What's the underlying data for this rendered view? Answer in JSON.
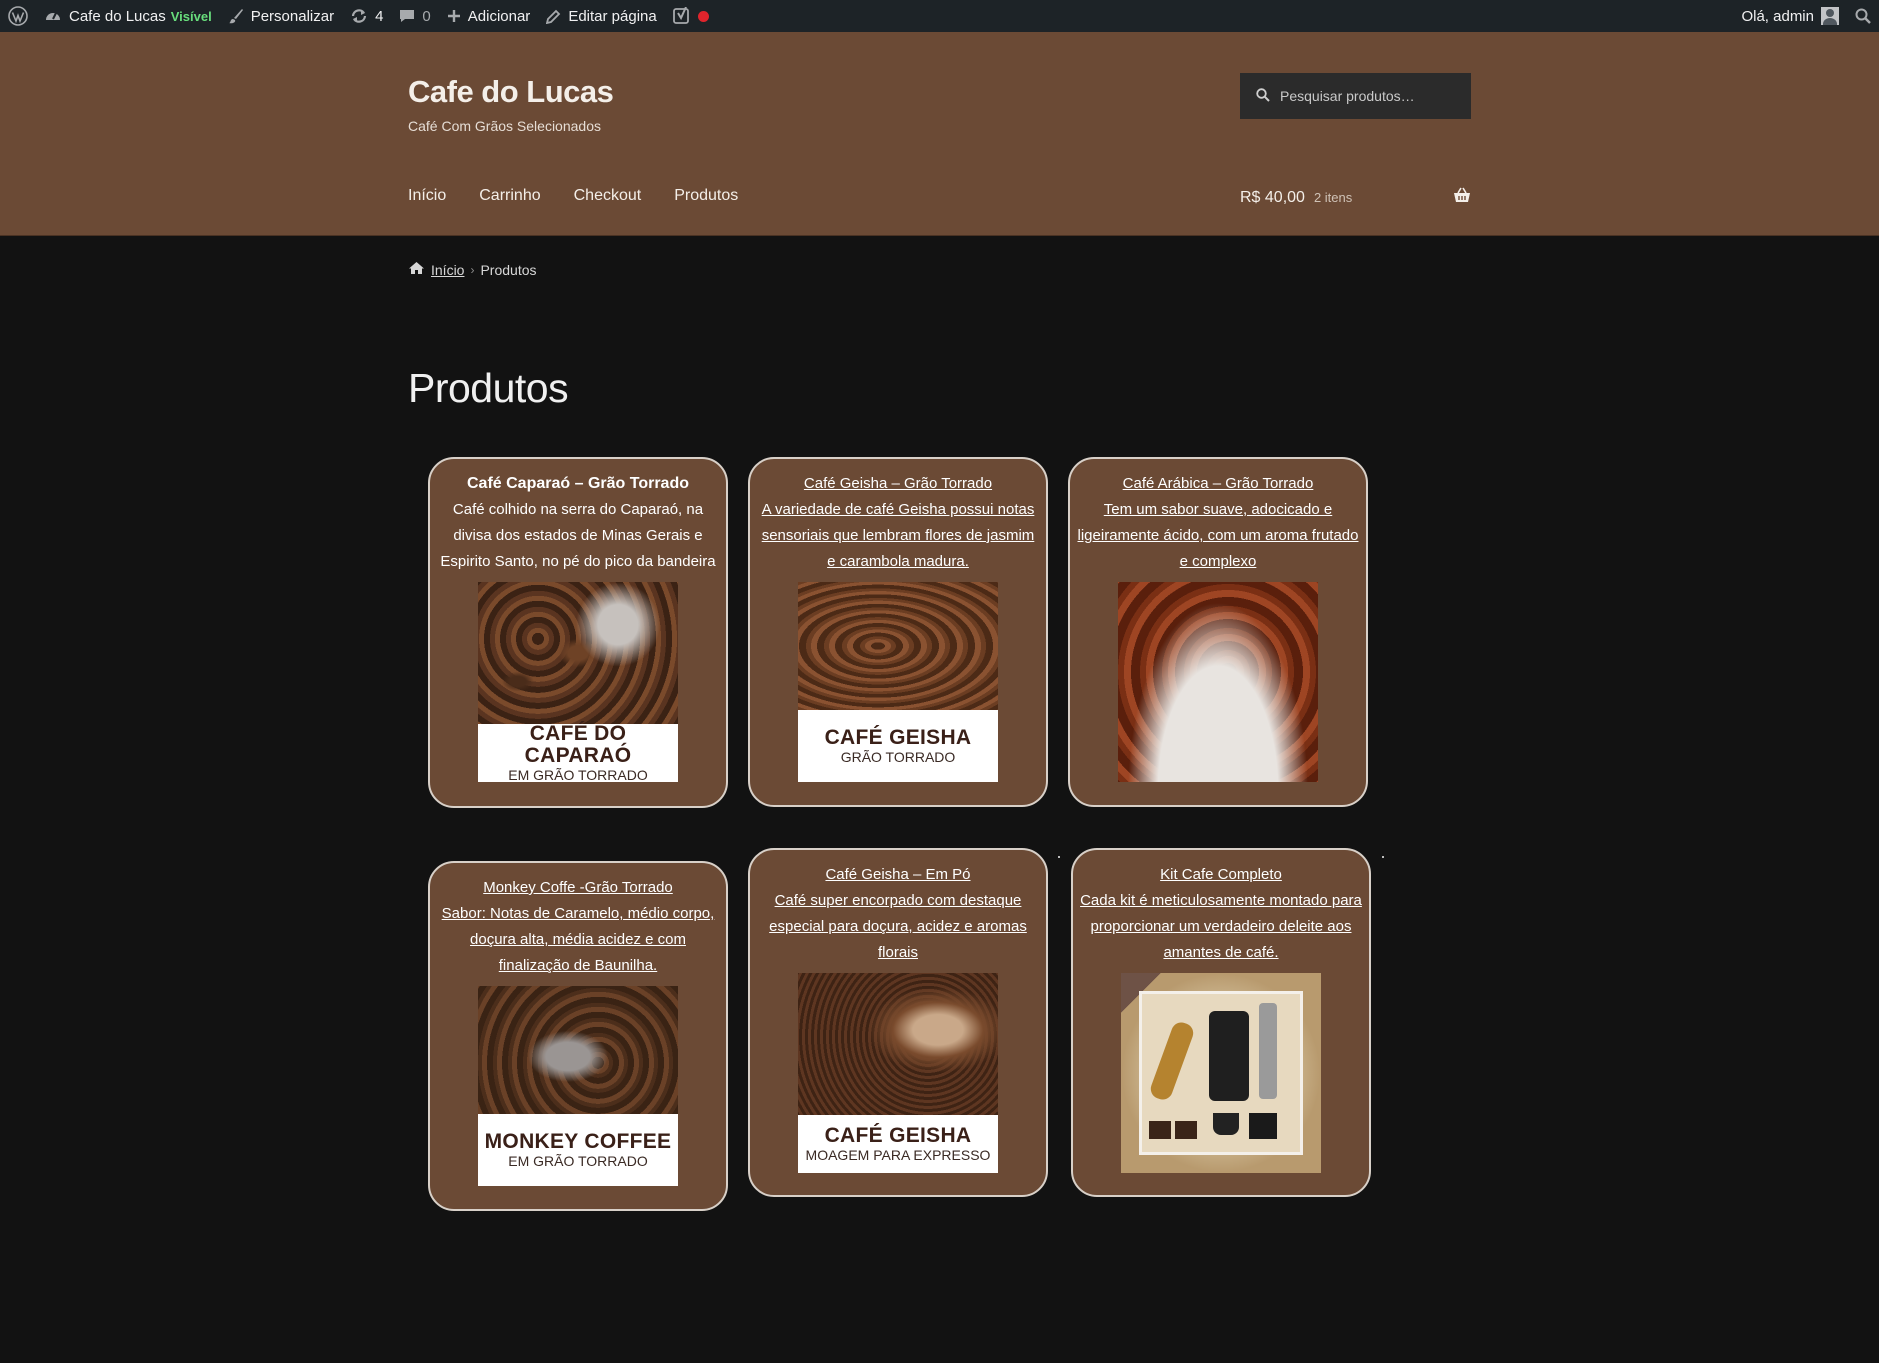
{
  "admin_bar": {
    "site_name": "Cafe do Lucas",
    "visibility": "Visível",
    "customize": "Personalizar",
    "updates_count": "4",
    "comments_count": "0",
    "add_new": "Adicionar",
    "edit_page": "Editar página",
    "greeting": "Olá, admin"
  },
  "header": {
    "site_title": "Cafe do Lucas",
    "tagline": "Café Com Grãos Selecionados",
    "search_placeholder": "Pesquisar produtos…",
    "nav": [
      "Início",
      "Carrinho",
      "Checkout",
      "Produtos"
    ],
    "cart_total": "R$ 40,00",
    "cart_items": "2 itens"
  },
  "breadcrumb": {
    "home": "Início",
    "current": "Produtos"
  },
  "page": {
    "title": "Produtos"
  },
  "products": [
    {
      "title": "Café Caparaó – Grão Torrado",
      "description": "Café colhido na serra do Caparaó, na divisa dos estados de Minas Gerais e Espirito Santo, no pé do pico da bandeira",
      "label_main": "CAFÉ DO CAPARAÓ",
      "label_sub": "EM GRÃO TORRADO"
    },
    {
      "title": "Café Geisha – Grão Torrado",
      "description": "A variedade de café Geisha possui notas sensoriais que lembram flores de jasmim e carambola madura.",
      "label_main": "CAFÉ GEISHA",
      "label_sub": "GRÃO TORRADO"
    },
    {
      "title": "Café Arábica – Grão Torrado",
      "description": "Tem um sabor suave, adocicado e ligeiramente ácido, com um aroma frutado e complexo"
    },
    {
      "title": "Monkey Coffe -Grão Torrado",
      "description": "Sabor: Notas de Caramelo, médio corpo, doçura alta, média acidez e com finalização de Baunilha.",
      "label_main": "MONKEY COFFEE",
      "label_sub": "EM GRÃO TORRADO"
    },
    {
      "title": "Café Geisha – Em Pó",
      "description": "Café super encorpado com destaque especial para doçura, acidez e aromas florais",
      "label_main": "CAFÉ GEISHA",
      "label_sub": "MOAGEM PARA EXPRESSO"
    },
    {
      "title": "Kit Cafe Completo",
      "description": "Cada kit é meticulosamente montado para proporcionar um verdadeiro deleite aos amantes de café."
    }
  ],
  "colors": {
    "header_bg": "#6b4a35",
    "page_bg": "#121212",
    "admin_bar_bg": "#1d2327",
    "card_border": "#d8d0c8",
    "visible_badge": "#68de7c",
    "record_dot": "#e0242c"
  },
  "icons": {
    "admin_bar": [
      "wordpress-logo-icon",
      "dashboard-icon",
      "brush-icon",
      "updates-icon",
      "comment-icon",
      "plus-icon",
      "pencil-icon",
      "yoast-icon",
      "record-dot-icon",
      "avatar-icon",
      "search-icon"
    ],
    "header": [
      "search-icon",
      "basket-icon",
      "home-icon"
    ]
  }
}
